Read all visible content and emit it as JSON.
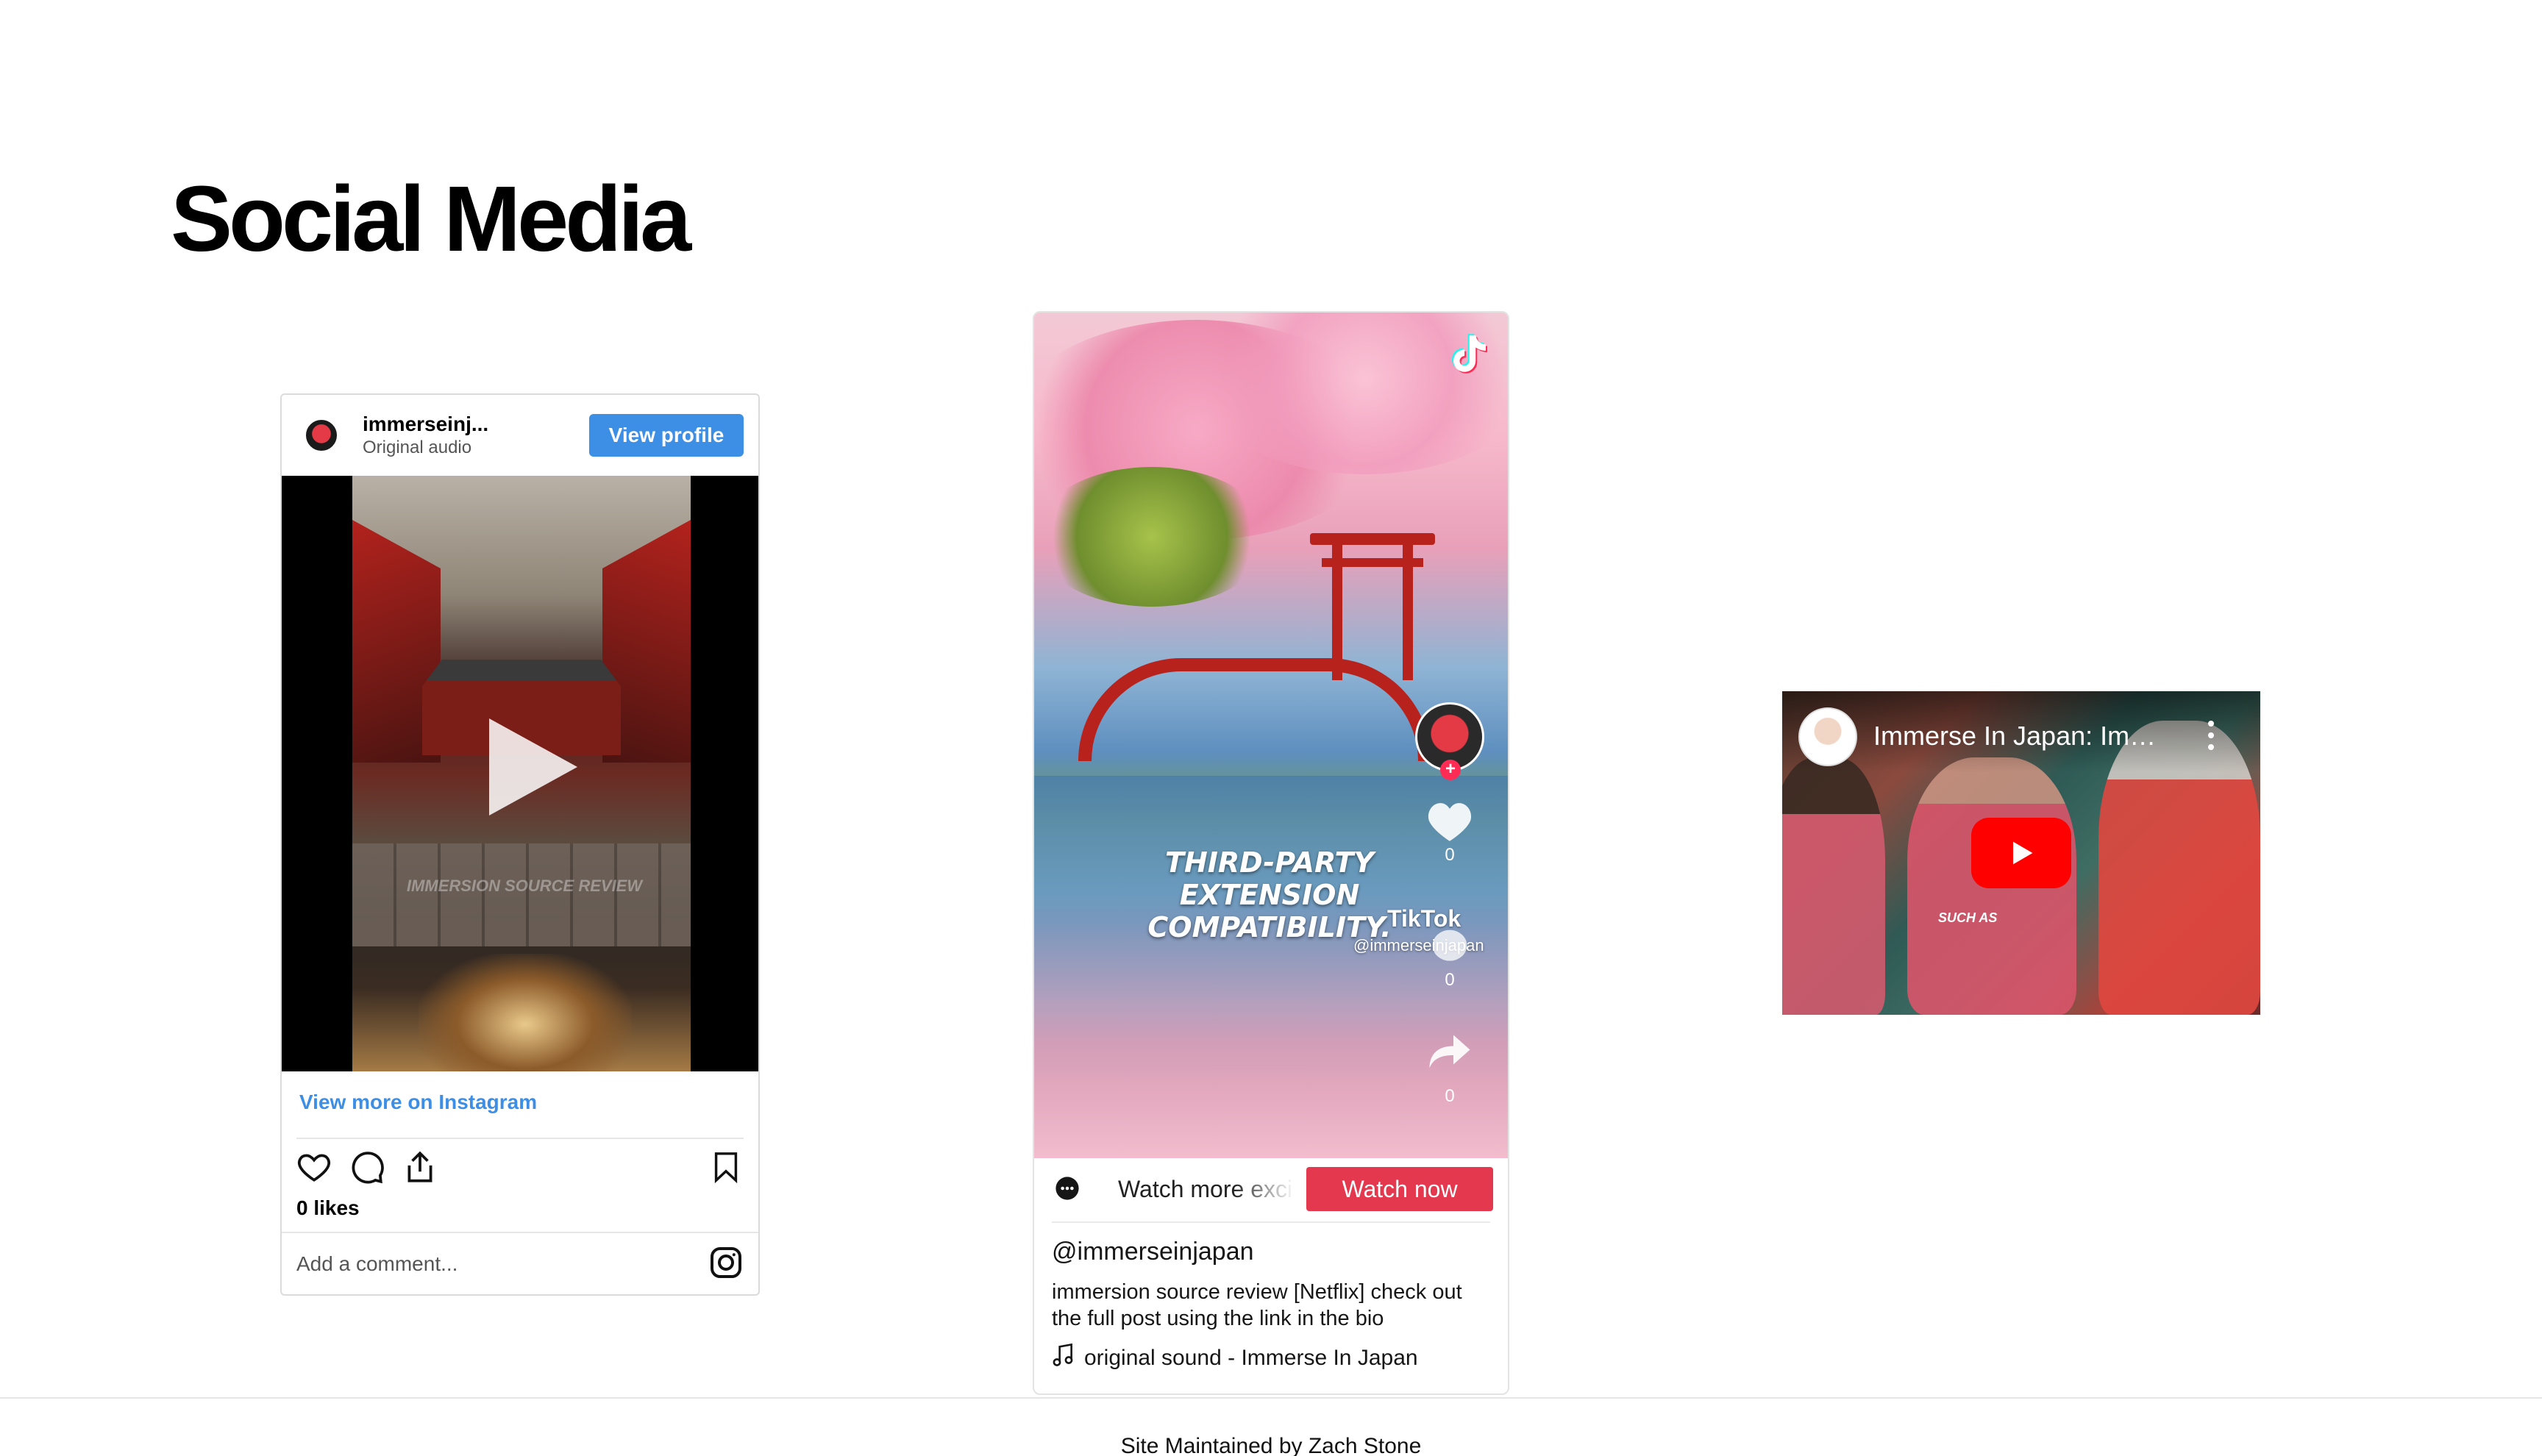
{
  "page": {
    "title": "Social Media"
  },
  "instagram": {
    "username": "immerseinj...",
    "subtitle": "Original audio",
    "view_profile_label": "View profile",
    "media_overlay_text": "IMMERSION SOURCE REVIEW",
    "view_more_label": "View more on Instagram",
    "likes": "0 likes",
    "comment_placeholder": "Add a comment..."
  },
  "tiktok": {
    "headline": "THIRD-PARTY EXTENSION COMPATIBILITY.",
    "like_count": "0",
    "comment_count": "0",
    "share_count": "0",
    "watermark_brand": "TikTok",
    "watermark_handle": "@immerseinjapan",
    "bar_text": "Watch more exciting videos on TikTok",
    "watch_now_label": "Watch now",
    "handle": "@immerseinjapan",
    "description": "immersion source review [Netflix] check out the full post using the link in the bio",
    "sound": "original sound - Immerse In Japan",
    "accent_color": "#e4384f"
  },
  "youtube": {
    "title": "Immerse In Japan: Imm...",
    "caption": "SUCH AS",
    "play_color": "#ff0000"
  },
  "footer": {
    "text": "Site Maintained by Zach Stone"
  }
}
